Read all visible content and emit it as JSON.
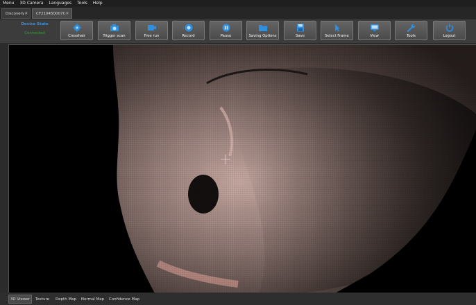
{
  "menu": [
    "Menu",
    "3D Camera",
    "Languages",
    "Tools",
    "Help"
  ],
  "tabs": [
    {
      "label": "Discovery"
    },
    {
      "label": "CF210450007C"
    }
  ],
  "device": {
    "label": "Device State",
    "status": "Connected"
  },
  "toolbar": [
    {
      "label": "Crosshair",
      "icon": "crosshair-icon"
    },
    {
      "label": "Trigger scan",
      "icon": "camera-icon"
    },
    {
      "label": "Free run",
      "icon": "video-camera-icon"
    },
    {
      "label": "Record",
      "icon": "record-icon"
    },
    {
      "label": "Pause",
      "icon": "pause-icon"
    },
    {
      "label": "Saving Options",
      "icon": "folder-icon"
    },
    {
      "label": "Save",
      "icon": "floppy-disk-icon"
    },
    {
      "label": "Select Frame",
      "icon": "cursor-icon"
    },
    {
      "label": "View",
      "icon": "monitor-icon"
    },
    {
      "label": "Tools",
      "icon": "wrench-icon"
    },
    {
      "label": "Logout",
      "icon": "power-icon"
    }
  ],
  "view_tabs": [
    "3D Viewer",
    "Texture",
    "Depth Map",
    "Normal Map",
    "Confidence Map"
  ],
  "active_view_tab": "3D Viewer",
  "colors": {
    "accent": "#3e8fd6",
    "status_ok": "#2ea52e",
    "button_icon": "#2f8fe0"
  }
}
